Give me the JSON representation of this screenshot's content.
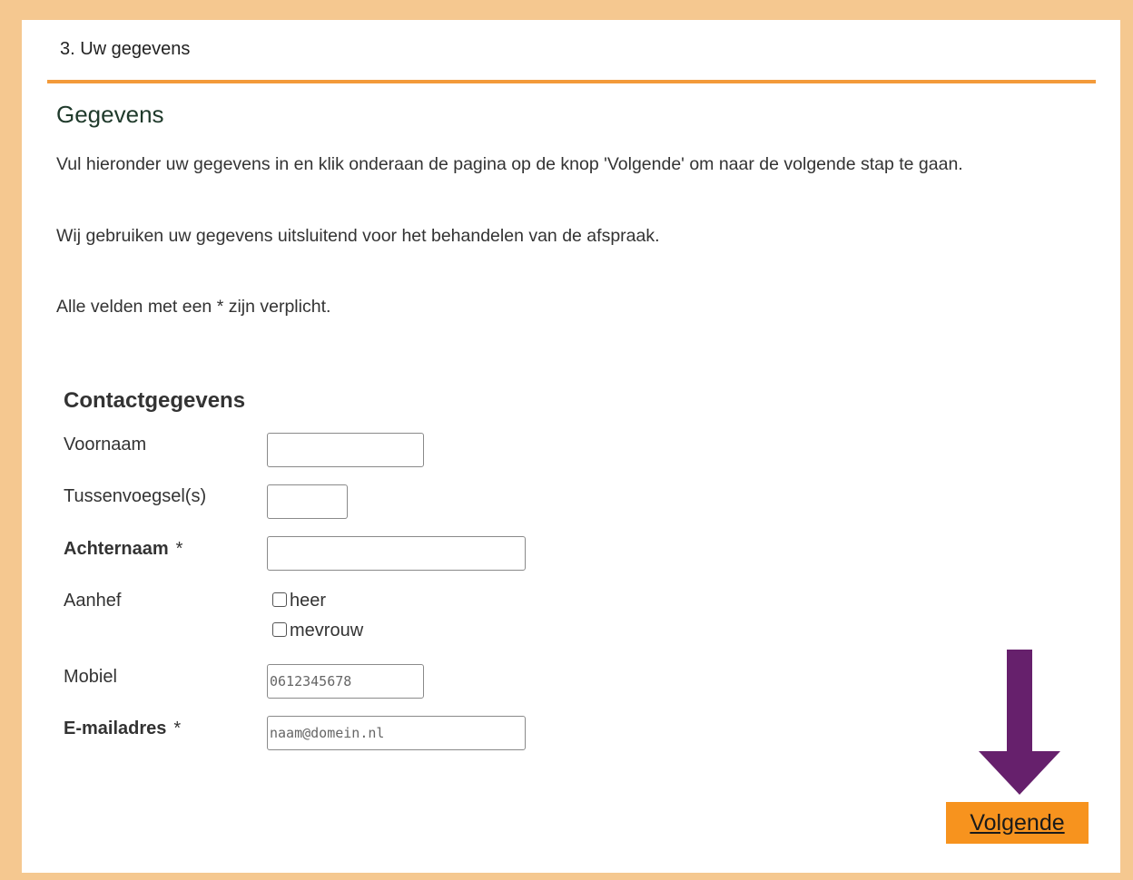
{
  "step": {
    "header": "3. Uw gegevens"
  },
  "section": {
    "title": "Gegevens",
    "paragraphs": [
      "Vul hieronder uw gegevens in en klik onderaan de pagina op de knop 'Volgende' om naar de volgende stap te gaan.",
      "Wij gebruiken uw gegevens uitsluitend voor het behandelen van de afspraak.",
      "Alle velden met een * zijn verplicht."
    ]
  },
  "form": {
    "title": "Contactgegevens",
    "required_marker": "*",
    "voornaam": {
      "label": "Voornaam",
      "value": ""
    },
    "tussenvoegsel": {
      "label": "Tussenvoegsel(s)",
      "value": ""
    },
    "achternaam": {
      "label": "Achternaam",
      "value": ""
    },
    "aanhef": {
      "label": "Aanhef",
      "options": [
        {
          "label": "heer",
          "checked": false
        },
        {
          "label": "mevrouw",
          "checked": false
        }
      ]
    },
    "mobiel": {
      "label": "Mobiel",
      "placeholder": "0612345678"
    },
    "email": {
      "label": "E-mailadres",
      "placeholder": "naam@domein.nl"
    }
  },
  "navigation": {
    "next_label": "Volgende"
  },
  "colors": {
    "frame": "#f5c890",
    "accent_rule": "#f39a3a",
    "button": "#f7931e",
    "arrow": "#66206c"
  },
  "icons": {
    "arrow": "arrow-down-icon"
  }
}
